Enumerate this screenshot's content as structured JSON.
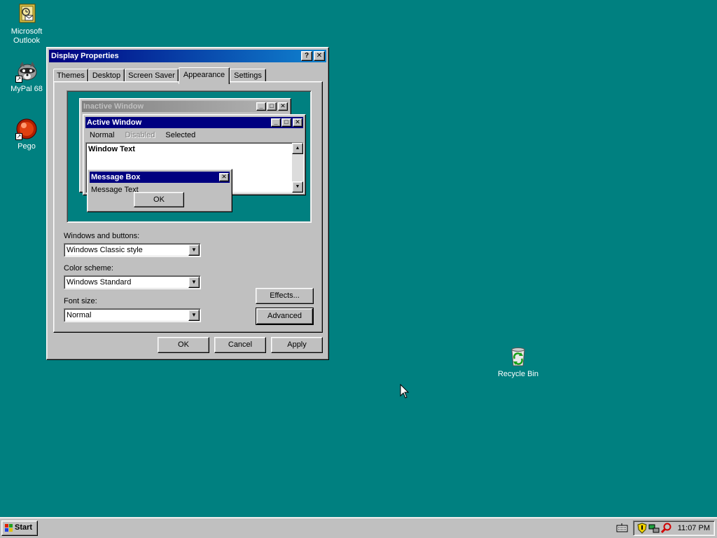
{
  "desktop": {
    "icons": [
      {
        "label": "Microsoft Outlook",
        "icon": "outlook-icon"
      },
      {
        "label": "MyPal 68",
        "icon": "raccoon-icon"
      },
      {
        "label": "Pego",
        "icon": "pego-icon"
      },
      {
        "label": "Recycle Bin",
        "icon": "recycle-bin-icon"
      }
    ],
    "background_color": "#008080"
  },
  "dialog": {
    "title": "Display Properties",
    "help_btn": "?",
    "close_btn": "✕",
    "tabs": [
      {
        "label": "Themes",
        "active": false
      },
      {
        "label": "Desktop",
        "active": false
      },
      {
        "label": "Screen Saver",
        "active": false
      },
      {
        "label": "Appearance",
        "active": true
      },
      {
        "label": "Settings",
        "active": false
      }
    ],
    "preview": {
      "inactive_title": "Inactive Window",
      "active_title": "Active Window",
      "menu": {
        "normal": "Normal",
        "disabled": "Disabled",
        "selected": "Selected"
      },
      "window_text": "Window Text",
      "message_box_title": "Message Box",
      "message_text": "Message Text",
      "ok": "OK"
    },
    "fields": {
      "windows_buttons_label": "Windows and buttons:",
      "windows_buttons_value": "Windows Classic style",
      "color_scheme_label": "Color scheme:",
      "color_scheme_value": "Windows Standard",
      "font_size_label": "Font size:",
      "font_size_value": "Normal"
    },
    "effects_btn": "Effects...",
    "advanced_btn": "Advanced",
    "ok_btn": "OK",
    "cancel_btn": "Cancel",
    "apply_btn": "Apply"
  },
  "taskbar": {
    "start_label": "Start",
    "clock": "11:07 PM"
  }
}
